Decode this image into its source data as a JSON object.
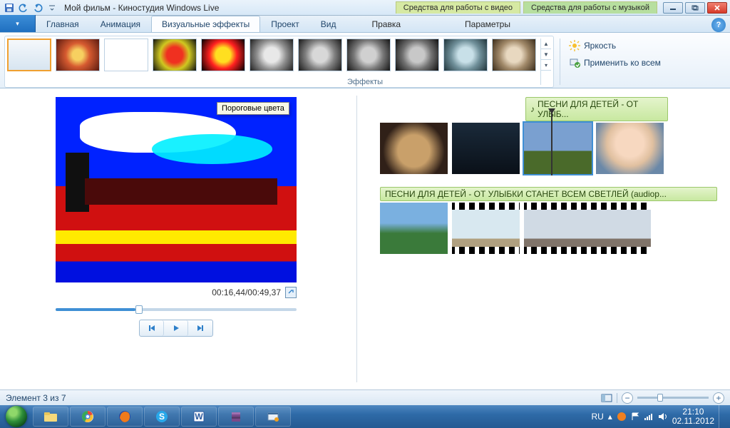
{
  "title": "Мой фильм - Киностудия Windows Live",
  "context_tabs": {
    "video": "Средства для работы с видео",
    "music": "Средства для работы с музыкой"
  },
  "ribbon_tabs": {
    "home": "Главная",
    "animation": "Анимация",
    "visual_effects": "Визуальные эффекты",
    "project": "Проект",
    "view": "Вид",
    "edit": "Правка",
    "options": "Параметры"
  },
  "ribbon": {
    "group_label": "Эффекты",
    "brightness": "Яркость",
    "apply_all": "Применить ко всем"
  },
  "tooltip": "Пороговые цвета",
  "preview": {
    "time": "00:16,44/00:49,37"
  },
  "timeline": {
    "music1": "ПЕСНИ ДЛЯ ДЕТЕЙ - ОТ УЛЫБ...",
    "music2": "ПЕСНИ ДЛЯ ДЕТЕЙ - ОТ УЛЫБКИ СТАНЕТ ВСЕМ СВЕТЛЕЙ  (audiop..."
  },
  "status": {
    "item": "Элемент 3 из 7"
  },
  "tray": {
    "lang": "RU",
    "time": "21:10",
    "date": "02.11.2012"
  }
}
